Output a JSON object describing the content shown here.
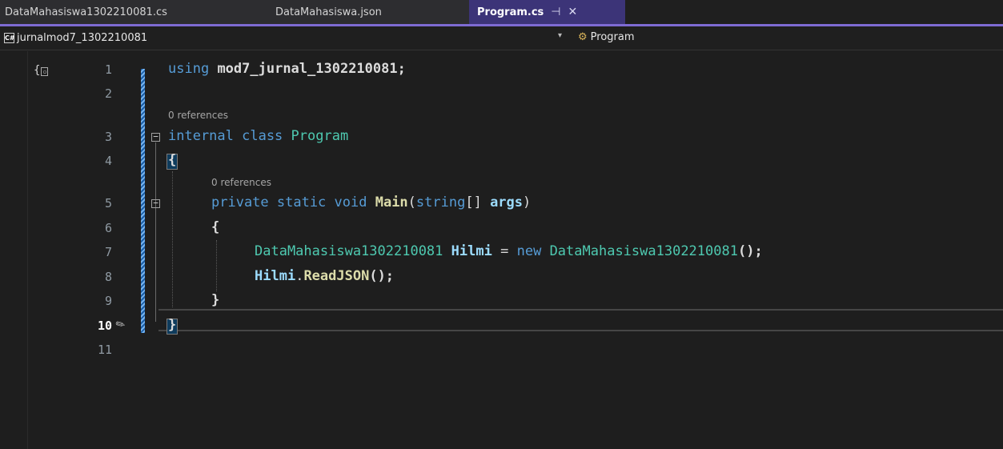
{
  "tabs": [
    {
      "label": "DataMahasiswa1302210081.cs",
      "active": false
    },
    {
      "label": "DataMahasiswa.json",
      "active": false
    },
    {
      "label": "Program.cs",
      "active": true
    }
  ],
  "tab_icons": {
    "pin": "⊣",
    "close": "✕"
  },
  "navbar": {
    "project_badge": "C#",
    "project": "jurnalmod7_1302210081",
    "dropdown": "▾",
    "member": "Program"
  },
  "gutter": {
    "lines": [
      "1",
      "2",
      "3",
      "4",
      "5",
      "6",
      "7",
      "8",
      "9",
      "10",
      "11"
    ],
    "current_line": "10"
  },
  "codelens": {
    "ref3": "0 references",
    "ref5": "0 references"
  },
  "code": {
    "l1_kw": "using",
    "l1_ns": "mod7_jurnal_1302210081;",
    "l3_kw": "internal class",
    "l3_type": "Program",
    "l4": "{",
    "l5_kw": "private static void",
    "l5_method": "Main",
    "l5_paren": "(",
    "l5_kw2": "string",
    "l5_rest": "[] ",
    "l5_param": "args",
    "l5_close": ")",
    "l6": "{",
    "l7_type": "DataMahasiswa1302210081",
    "l7_var": "Hilmi",
    "l7_eq": "=",
    "l7_new": "new",
    "l7_type2": "DataMahasiswa1302210081",
    "l7_end": "();",
    "l8_var": "Hilmi",
    "l8_dot": ".",
    "l8_method": "ReadJSON",
    "l8_end": "();",
    "l9": "}",
    "l10": "}"
  },
  "colors": {
    "accent": "#7e6bd3",
    "keyword": "#569cd6",
    "type": "#4ec9b0",
    "method": "#dcdcaa",
    "identifier": "#9cdcfe"
  }
}
